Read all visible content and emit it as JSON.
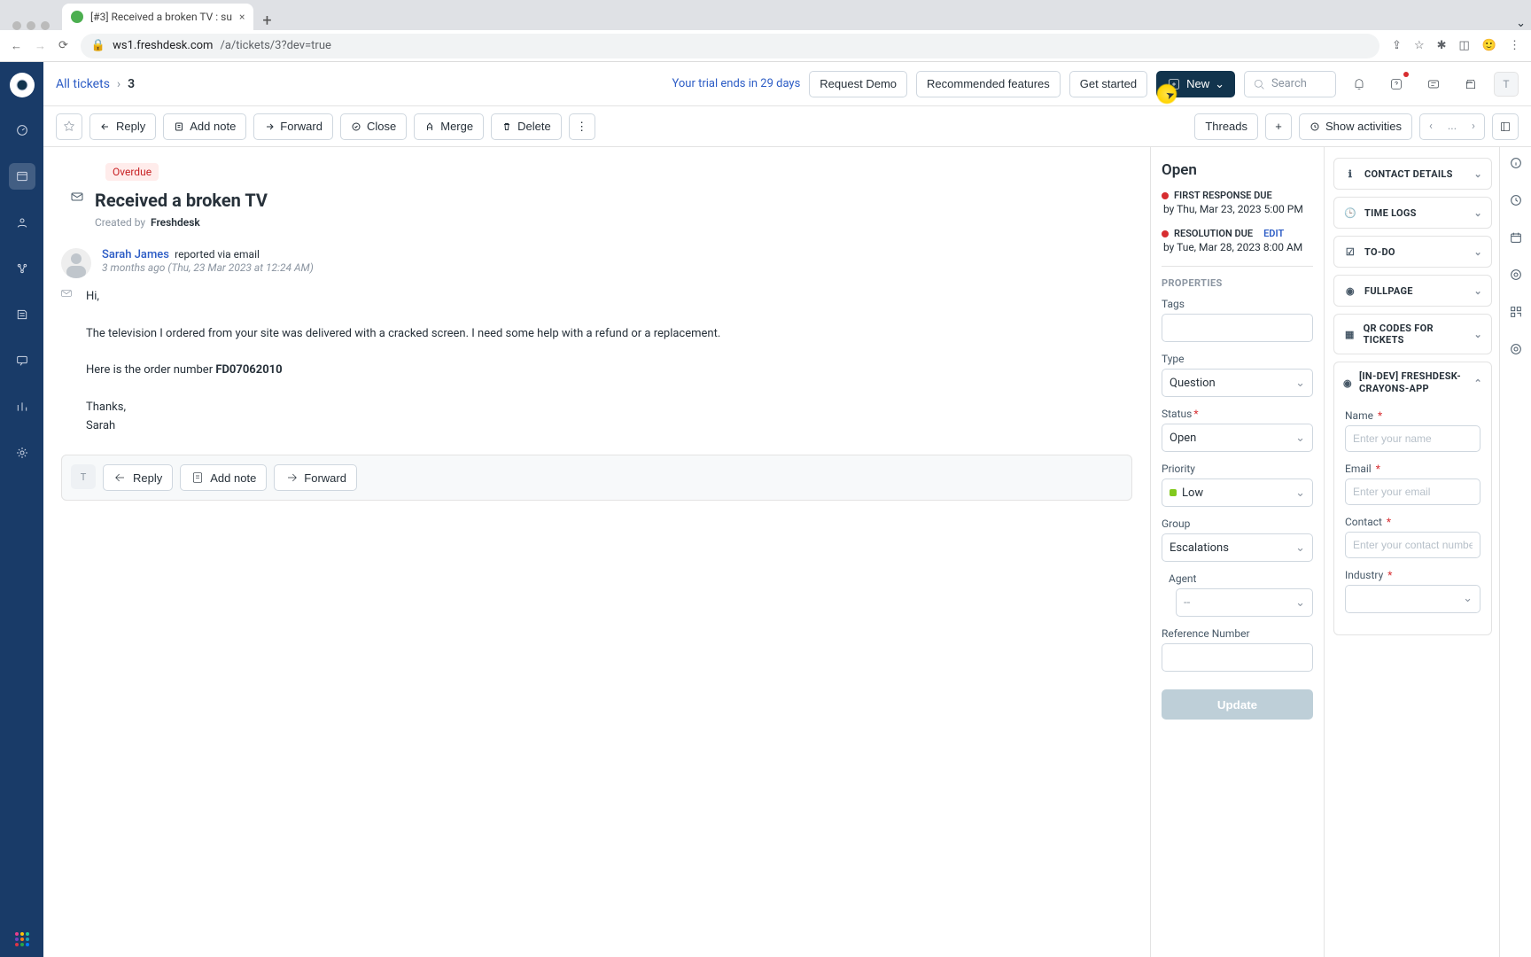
{
  "browser": {
    "tab_title": "[#3] Received a broken TV : su",
    "url_host": "ws1.freshdesk.com",
    "url_path": "/a/tickets/3?dev=true"
  },
  "breadcrumb": {
    "root": "All tickets",
    "id": "3"
  },
  "topbar": {
    "trial": "Your trial ends in 29 days",
    "request_demo": "Request Demo",
    "recommended": "Recommended features",
    "get_started": "Get started",
    "new": "New",
    "search_placeholder": "Search",
    "avatar": "T"
  },
  "actionbar": {
    "reply": "Reply",
    "add_note": "Add note",
    "forward": "Forward",
    "close": "Close",
    "merge": "Merge",
    "delete": "Delete",
    "threads": "Threads",
    "show_activities": "Show activities",
    "pager_mid": "..."
  },
  "ticket": {
    "overdue": "Overdue",
    "subject": "Received a broken TV",
    "created_by_label": "Created by",
    "created_by": "Freshdesk",
    "requester": "Sarah James",
    "mode": "reported via email",
    "time": "3 months ago (Thu, 23 Mar 2023 at 12:24 AM)",
    "body_greeting": "Hi,",
    "body_main": "The television I ordered from your site was delivered with a cracked screen. I need some help with a refund or a replacement.",
    "body_order_prefix": "Here is the order number ",
    "body_order_num": "FD07062010",
    "body_thanks": "Thanks,",
    "body_sign": "Sarah"
  },
  "replybox": {
    "reply": "Reply",
    "add_note": "Add note",
    "forward": "Forward",
    "avatar": "T"
  },
  "status_col": {
    "status": "Open",
    "first_due_label": "FIRST RESPONSE DUE",
    "first_due_val": "by Thu, Mar 23, 2023 5:00 PM",
    "res_due_label": "RESOLUTION DUE",
    "res_due_val": "by Tue, Mar 28, 2023 8:00 AM",
    "edit": "Edit",
    "properties": "PROPERTIES",
    "tags": "Tags",
    "type": "Type",
    "type_val": "Question",
    "status_label": "Status",
    "status_val": "Open",
    "priority": "Priority",
    "priority_val": "Low",
    "group": "Group",
    "group_val": "Escalations",
    "agent": "Agent",
    "agent_val": "--",
    "refnum": "Reference Number",
    "update": "Update"
  },
  "accordions": {
    "contact": "CONTACT DETAILS",
    "timelogs": "TIME LOGS",
    "todo": "TO-DO",
    "fullpage": "FULLPAGE",
    "qr": "QR CODES FOR TICKETS",
    "crayons": "[IN-DEV] FRESHDESK-CRAYONS-APP",
    "form": {
      "name": "Name",
      "name_ph": "Enter your name",
      "email": "Email",
      "email_ph": "Enter your email",
      "contact": "Contact",
      "contact_ph": "Enter your contact number",
      "industry": "Industry"
    }
  }
}
